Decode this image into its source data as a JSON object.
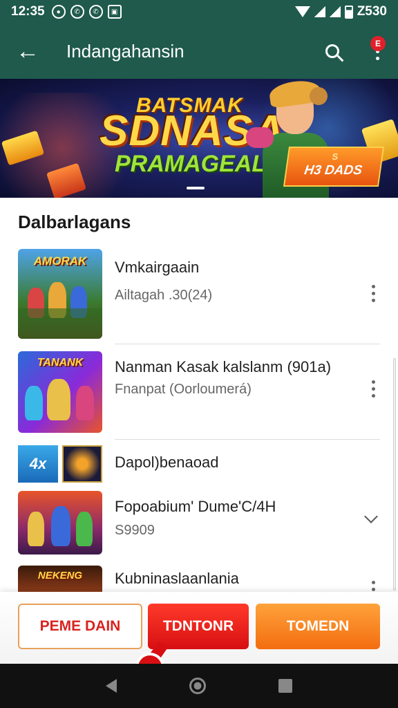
{
  "status_bar": {
    "time": "12:35",
    "battery_text": "Z530",
    "icons": [
      "notification-icon",
      "whatsapp-icon",
      "whatsapp-icon",
      "gallery-icon",
      "wifi-icon",
      "signal-icon",
      "signal-icon",
      "battery-icon"
    ]
  },
  "app_bar": {
    "title": "Indangahansin",
    "notification_count": "E"
  },
  "banner": {
    "line1": "BATSMAK",
    "line2": "SDNASAI",
    "line3": "PRAMAGEALS",
    "badge_top": "S",
    "badge_text": "H3 DADS"
  },
  "section": {
    "heading": "Dalbarlagans"
  },
  "list": [
    {
      "title": "Vmkairgaain",
      "subtitle": "Ailtagah .30(24)",
      "thumb_text": "AMORAK"
    },
    {
      "title": "Nanman Kasak kalslanm (901a)",
      "subtitle": "Fnanpat (Oorloumerá)",
      "thumb_text": "TANANK"
    },
    {
      "title": "Dapol)benaoad",
      "subtitle": "",
      "mini_text": "4x"
    },
    {
      "title": "Fopoabium' Dume'C/4H",
      "subtitle": "S9909",
      "thumb_text": ""
    },
    {
      "title": "Kubninaslaanlania",
      "subtitle": "",
      "thumb_text": "NEKENG"
    }
  ],
  "actions": {
    "button_1": "PEME DAIN",
    "button_2": "TDNTONR",
    "button_3": "TOMEDN"
  },
  "colors": {
    "app_bar": "#1f5a4c",
    "accent_red": "#d80f12",
    "accent_orange": "#f36d10"
  }
}
